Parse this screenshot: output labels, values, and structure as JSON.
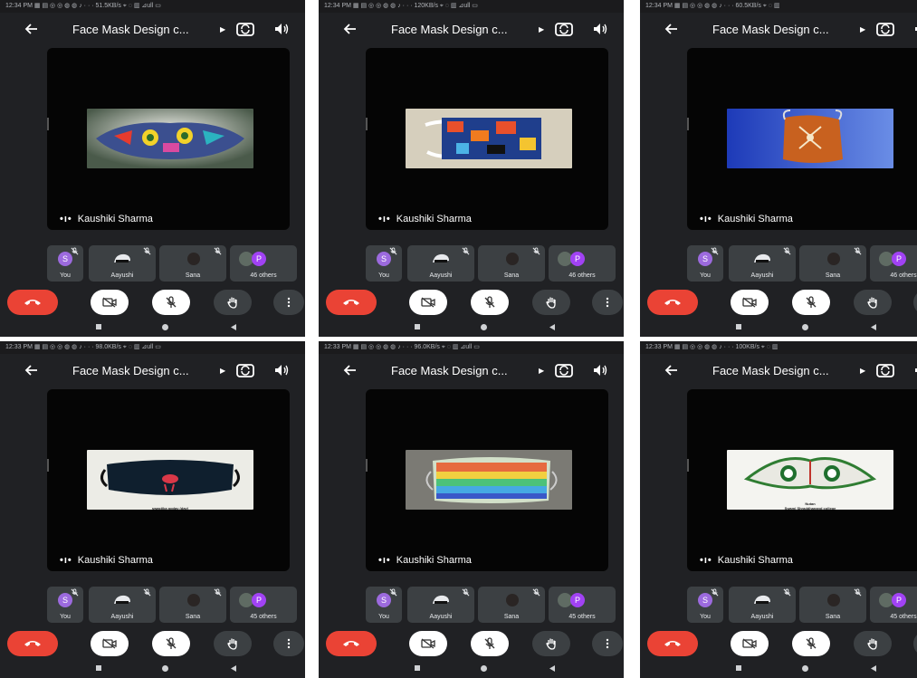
{
  "screens": [
    {
      "status": "12:34 PM ▦ ▤ ◎ ◎ ◍ ◍ ♪ · · · 51.5KB/s ⌖ ◌ ▥ ⊿ull ▭",
      "title": "Face Mask Design c...",
      "presenter": "Kaushiki Sharma",
      "others": "46 others",
      "caption": "",
      "mask": "mask1"
    },
    {
      "status": "12:34 PM ▦ ▤ ◎ ◎ ◍ ◍ ♪ · · · 120KB/s ⌖ ◌ ▥ ⊿ull ▭",
      "title": "Face Mask Design c...",
      "presenter": "Kaushiki Sharma",
      "others": "46 others",
      "caption": "",
      "mask": "mask2"
    },
    {
      "status": "12:34 PM ▦ ▤ ◎ ◎ ◍ ◍ ♪ · · · 60.5KB/s ⌖ ◌ ▥",
      "title": "Face Mask Design c...",
      "presenter": "Kaushiki Sharma",
      "others": "46 others",
      "caption": "",
      "mask": "mask3"
    },
    {
      "status": "12:33 PM ▦ ▤ ◎ ◎ ◍ ◍ ♪ · · · 98.0KB/s ⌖ ◌ ▥ ⊿ull ▭",
      "title": "Face Mask Design c...",
      "presenter": "Kaushiki Sharma",
      "others": "45 others",
      "caption": "swastika pgdav (day)",
      "mask": "mask4"
    },
    {
      "status": "12:33 PM ▦ ▤ ◎ ◎ ◍ ◍ ♪ · · · 96.0KB/s ⌖ ◌ ▥ ⊿ull ▭",
      "title": "Face Mask Design c...",
      "presenter": "Kaushiki Sharma",
      "others": "45 others",
      "caption": "",
      "mask": "mask5"
    },
    {
      "status": "12:33 PM ▦ ▤ ◎ ◎ ◍ ◍ ♪ · · · 100KB/s ⌖ ◌ ▥",
      "title": "Face Mask Design c...",
      "presenter": "Kaushiki Sharma",
      "others": "45 others",
      "caption": "Nutan\nSwami Shraddhanand college",
      "mask": "mask6"
    }
  ],
  "participants": {
    "you_initial": "S",
    "you": "You",
    "p2": "Aayushi",
    "p3": "Sana",
    "others_initial": "P"
  },
  "colors": {
    "end_call": "#ea4335",
    "avatar_s": "#9c6ade",
    "avatar_p": "#a142f4",
    "background": "#202124",
    "tile": "#3c4043"
  },
  "icons": [
    "back-arrow-icon",
    "switch-camera-icon",
    "speaker-icon",
    "mic-off-icon",
    "end-call-icon",
    "camera-off-icon",
    "raise-hand-icon",
    "more-icon",
    "nav-square-icon",
    "nav-circle-icon",
    "nav-triangle-icon"
  ]
}
